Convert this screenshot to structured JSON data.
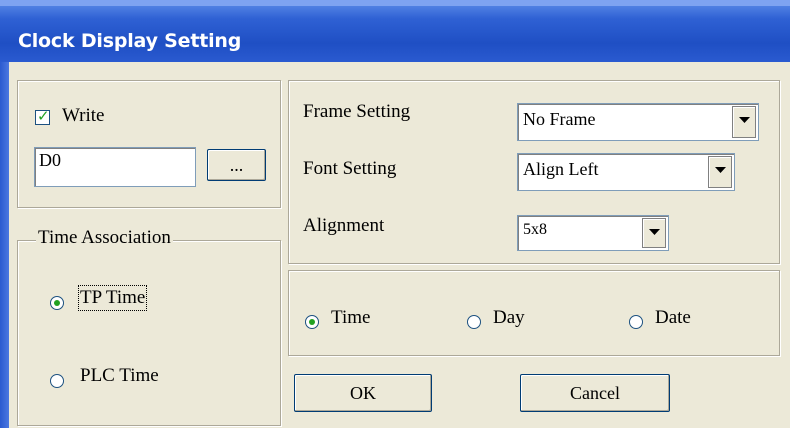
{
  "window": {
    "title": "Clock Display Setting"
  },
  "write_group": {
    "checkbox_label": "Write",
    "checked": true,
    "address_value": "D0",
    "browse_label": "..."
  },
  "time_association": {
    "legend": "Time Association",
    "options": [
      {
        "label": "TP Time",
        "selected": true
      },
      {
        "label": "PLC Time",
        "selected": false
      }
    ]
  },
  "settings": {
    "frame": {
      "label": "Frame Setting",
      "value": "No Frame"
    },
    "font": {
      "label": "Font Setting",
      "value": "Align Left"
    },
    "alignment": {
      "label": "Alignment",
      "value": "5x8"
    }
  },
  "display_mode": {
    "options": [
      {
        "label": "Time",
        "selected": true
      },
      {
        "label": "Day",
        "selected": false
      },
      {
        "label": "Date",
        "selected": false
      }
    ]
  },
  "buttons": {
    "ok": "OK",
    "cancel": "Cancel"
  },
  "colors": {
    "titlebar": "#1f4fc4",
    "face": "#ECE9D8",
    "check": "#21a121"
  }
}
